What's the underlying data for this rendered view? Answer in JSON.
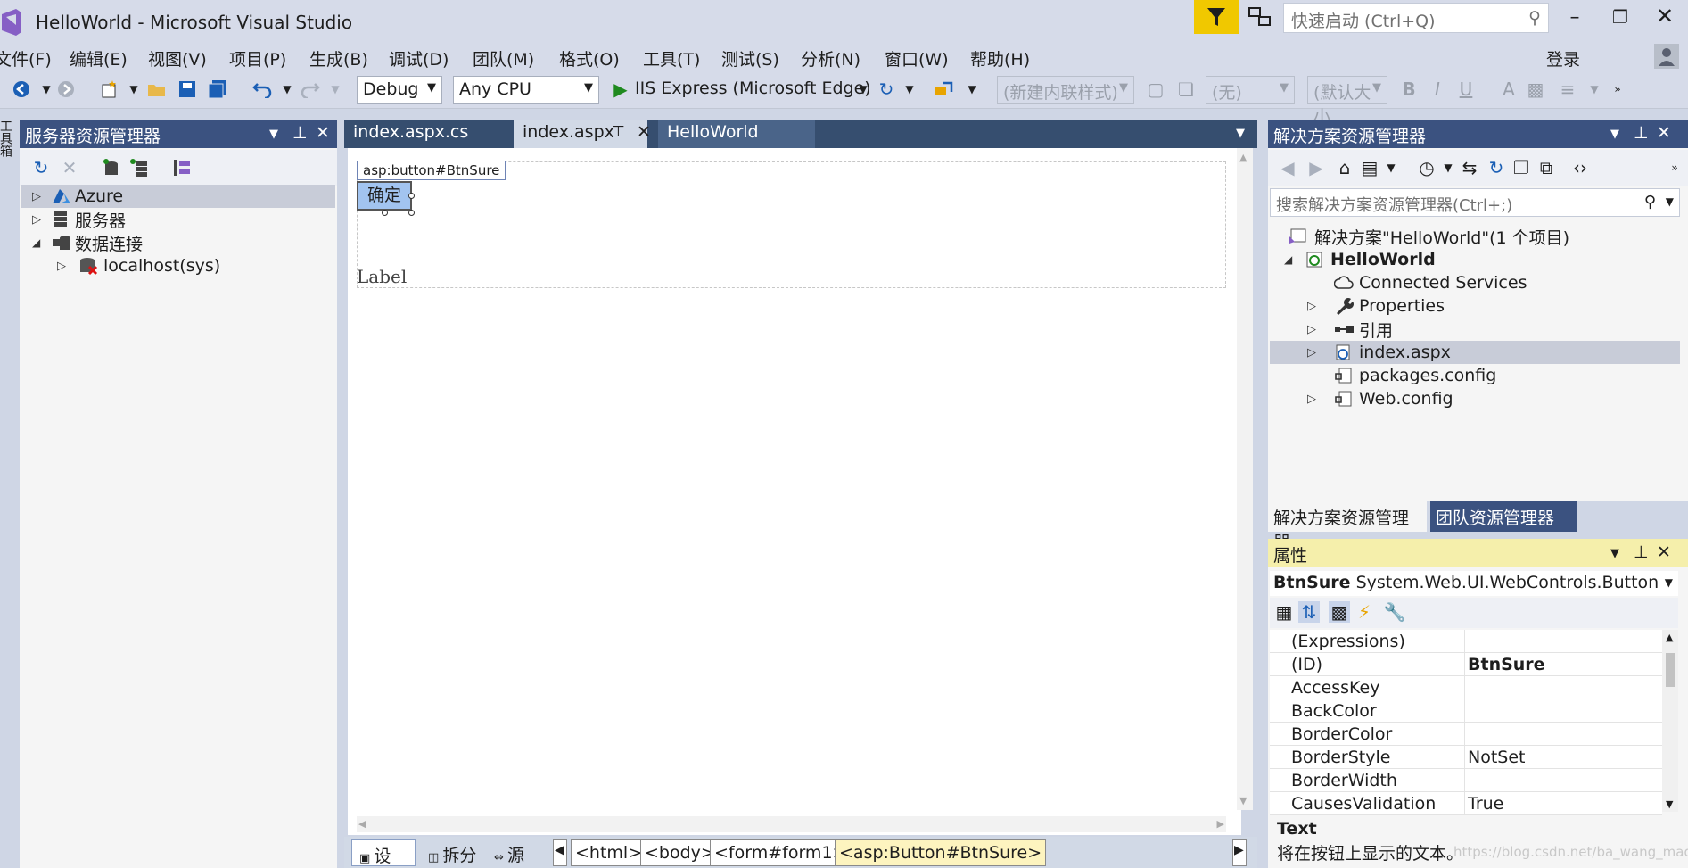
{
  "window": {
    "title": "HelloWorld - Microsoft Visual Studio",
    "quick_launch_placeholder": "快速启动 (Ctrl+Q)",
    "login": "登录"
  },
  "menu": [
    "文件(F)",
    "编辑(E)",
    "视图(V)",
    "项目(P)",
    "生成(B)",
    "调试(D)",
    "团队(M)",
    "格式(O)",
    "工具(T)",
    "测试(S)",
    "分析(N)",
    "窗口(W)",
    "帮助(H)"
  ],
  "toolbar": {
    "config": "Debug",
    "platform": "Any CPU",
    "run_target": "IIS Express (Microsoft Edge)",
    "style_combo": "(新建内联样式)",
    "target_combo": "(无)",
    "font_combo": "(默认大小",
    "bold": "B",
    "italic": "I",
    "underline": "U"
  },
  "left_strip": {
    "toolbox": "工具箱"
  },
  "server_explorer": {
    "title": "服务器资源管理器",
    "tree": [
      {
        "label": "Azure"
      },
      {
        "label": "服务器"
      },
      {
        "label": "数据连接"
      },
      {
        "label": "localhost(sys)"
      }
    ]
  },
  "editor": {
    "tabs": [
      "index.aspx.cs",
      "index.aspx",
      "HelloWorld"
    ],
    "tag_label": "asp:button#BtnSure",
    "button_text": "确定",
    "label_text": "Label",
    "views": [
      "设计",
      "拆分",
      "源"
    ],
    "breadcrumbs": [
      "<html>",
      "<body>",
      "<form#form1>",
      "<asp:Button#BtnSure>"
    ]
  },
  "solution_explorer": {
    "title": "解决方案资源管理器",
    "search_placeholder": "搜索解决方案资源管理器(Ctrl+;)",
    "solution": "解决方案\"HelloWorld\"(1 个项目)",
    "project": "HelloWorld",
    "items": [
      "Connected Services",
      "Properties",
      "引用",
      "index.aspx",
      "packages.config",
      "Web.config"
    ],
    "bottom_tabs": [
      "解决方案资源管理器",
      "团队资源管理器"
    ]
  },
  "properties": {
    "title": "属性",
    "object_name": "BtnSure",
    "object_type": "System.Web.UI.WebControls.Button",
    "rows": [
      {
        "name": "(Expressions)",
        "value": ""
      },
      {
        "name": "(ID)",
        "value": "BtnSure"
      },
      {
        "name": "AccessKey",
        "value": ""
      },
      {
        "name": "BackColor",
        "value": ""
      },
      {
        "name": "BorderColor",
        "value": ""
      },
      {
        "name": "BorderStyle",
        "value": "NotSet"
      },
      {
        "name": "BorderWidth",
        "value": ""
      },
      {
        "name": "CausesValidation",
        "value": "True"
      }
    ],
    "desc_title": "Text",
    "desc_text": "将在按钮上显示的文本。"
  },
  "watermark": "https://blog.csdn.net/ba_wang_mao",
  "colors": {
    "panel_header": "#3b5280",
    "active_header": "#f5efab",
    "filter_accent": "#f0c800"
  }
}
